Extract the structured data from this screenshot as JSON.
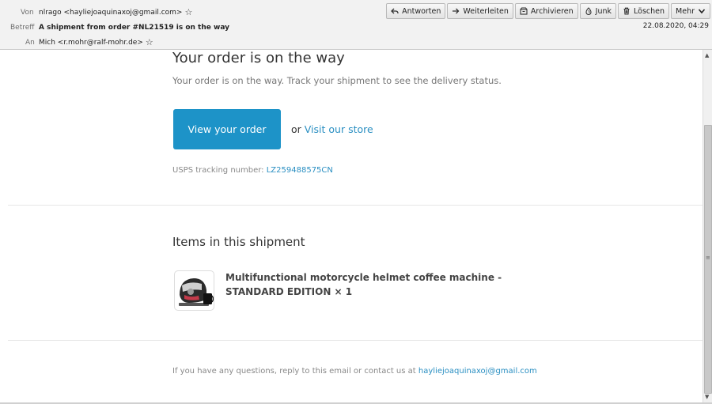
{
  "header": {
    "from_label": "Von",
    "from_value": "nlrago <hayliejoaquinaxoj@gmail.com>",
    "subject_label": "Betreff",
    "subject_value": "A shipment from order #NL21519 is on the way",
    "to_label": "An",
    "to_value": "Mich <r.mohr@ralf-mohr.de>",
    "date": "22.08.2020, 04:29",
    "star_glyph": "☆",
    "toolbar": [
      {
        "label": "Antworten",
        "icon": "reply-icon"
      },
      {
        "label": "Weiterleiten",
        "icon": "forward-icon"
      },
      {
        "label": "Archivieren",
        "icon": "archive-icon"
      },
      {
        "label": "Junk",
        "icon": "junk-icon"
      },
      {
        "label": "Löschen",
        "icon": "trash-icon"
      },
      {
        "label": "Mehr",
        "icon": "chevron-down-icon"
      }
    ]
  },
  "email": {
    "title": "Your order is on the way",
    "subtitle": "Your order is on the way. Track your shipment to see the delivery status.",
    "view_order_button": "View your order",
    "or_text": "or",
    "store_link": "Visit our store",
    "tracking_label": "USPS tracking number:",
    "tracking_number": "LZ259488575CN",
    "items_title": "Items in this shipment",
    "item_name": "Multifunctional motorcycle helmet coffee machine - STANDARD EDITION × 1",
    "footer_text": "If you have any questions, reply to this email or contact us at",
    "footer_email": "hayliejoaquinaxoj@gmail.com"
  },
  "colors": {
    "accent": "#1d93c8",
    "link": "#2a8fc2"
  }
}
